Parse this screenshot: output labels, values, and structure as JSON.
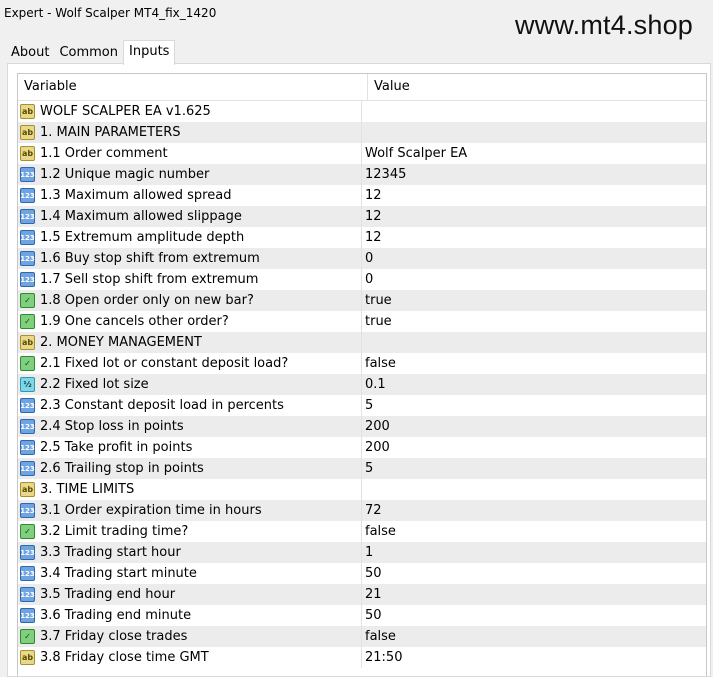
{
  "window": {
    "title": "Expert - Wolf Scalper MT4_fix_1420",
    "watermark": "www.mt4.shop"
  },
  "tabs": [
    {
      "label": "About",
      "active": false
    },
    {
      "label": "Common",
      "active": false
    },
    {
      "label": "Inputs",
      "active": true
    }
  ],
  "grid": {
    "headers": {
      "variable": "Variable",
      "value": "Value"
    },
    "rows": [
      {
        "icon": "string-icon",
        "name": "WOLF SCALPER EA v1.625",
        "value": ""
      },
      {
        "icon": "string-icon",
        "name": "1. MAIN PARAMETERS",
        "value": ""
      },
      {
        "icon": "string-icon",
        "name": "1.1 Order comment",
        "value": "Wolf Scalper EA"
      },
      {
        "icon": "integer-icon",
        "name": "1.2 Unique magic number",
        "value": "12345"
      },
      {
        "icon": "integer-icon",
        "name": "1.3 Maximum allowed spread",
        "value": "12"
      },
      {
        "icon": "integer-icon",
        "name": "1.4 Maximum allowed slippage",
        "value": "12"
      },
      {
        "icon": "integer-icon",
        "name": "1.5 Extremum amplitude depth",
        "value": "12"
      },
      {
        "icon": "integer-icon",
        "name": "1.6 Buy stop shift from extremum",
        "value": "0"
      },
      {
        "icon": "integer-icon",
        "name": "1.7 Sell stop shift from extremum",
        "value": "0"
      },
      {
        "icon": "bool-icon",
        "name": "1.8 Open order only on new bar?",
        "value": "true"
      },
      {
        "icon": "bool-icon",
        "name": "1.9 One cancels other order?",
        "value": "true"
      },
      {
        "icon": "string-icon",
        "name": "2. MONEY MANAGEMENT",
        "value": ""
      },
      {
        "icon": "bool-icon",
        "name": "2.1 Fixed lot or constant deposit load?",
        "value": "false"
      },
      {
        "icon": "double-icon",
        "name": "2.2 Fixed lot size",
        "value": "0.1"
      },
      {
        "icon": "integer-icon",
        "name": "2.3 Constant deposit load in percents",
        "value": "5"
      },
      {
        "icon": "integer-icon",
        "name": "2.4 Stop loss in points",
        "value": "200"
      },
      {
        "icon": "integer-icon",
        "name": "2.5 Take profit in points",
        "value": "200"
      },
      {
        "icon": "integer-icon",
        "name": "2.6 Trailing stop in points",
        "value": "5"
      },
      {
        "icon": "string-icon",
        "name": "3. TIME LIMITS",
        "value": ""
      },
      {
        "icon": "integer-icon",
        "name": "3.1 Order expiration time in hours",
        "value": "72"
      },
      {
        "icon": "bool-icon",
        "name": "3.2 Limit trading time?",
        "value": "false"
      },
      {
        "icon": "integer-icon",
        "name": "3.3 Trading start hour",
        "value": "1"
      },
      {
        "icon": "integer-icon",
        "name": "3.4 Trading start minute",
        "value": "50"
      },
      {
        "icon": "integer-icon",
        "name": "3.5 Trading end hour",
        "value": "21"
      },
      {
        "icon": "integer-icon",
        "name": "3.6 Trading end minute",
        "value": "50"
      },
      {
        "icon": "bool-icon",
        "name": "3.7 Friday close trades",
        "value": "false"
      },
      {
        "icon": "string-icon",
        "name": "3.8 Friday close time GMT",
        "value": "21:50"
      }
    ]
  }
}
